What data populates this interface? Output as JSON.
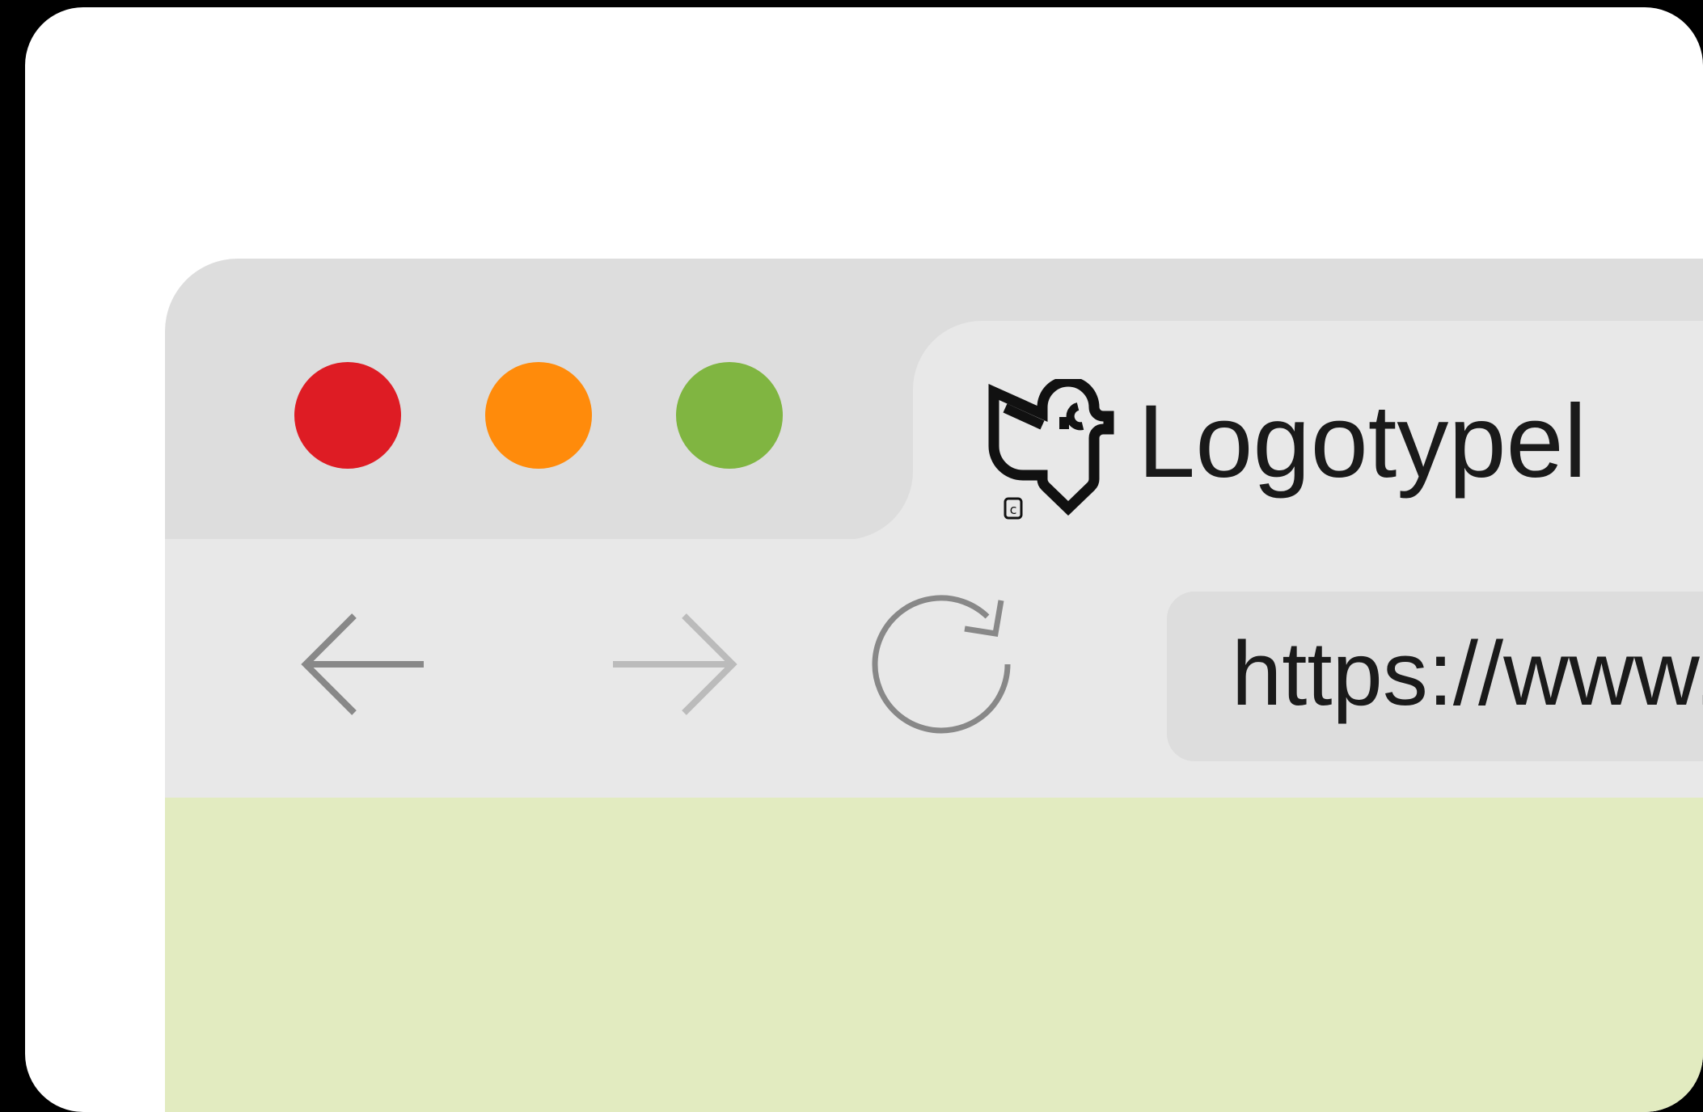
{
  "window": {
    "controls": {
      "close_color": "#de1c24",
      "minimize_color": "#ff8b0b",
      "maximize_color": "#80b541"
    }
  },
  "tab": {
    "title": "Logotypel",
    "icon": "logotype-bird-icon"
  },
  "toolbar": {
    "back_icon": "arrow-left-icon",
    "forward_icon": "arrow-right-icon",
    "reload_icon": "reload-icon"
  },
  "address_bar": {
    "url": "https://www."
  },
  "colors": {
    "chrome": "#dddddd",
    "tab_and_toolbar": "#e8e8e8",
    "page_background": "#e2ebc0",
    "frame": "#ffffff",
    "back_icon": "#888888",
    "forward_icon_disabled": "#bbbbbb"
  }
}
